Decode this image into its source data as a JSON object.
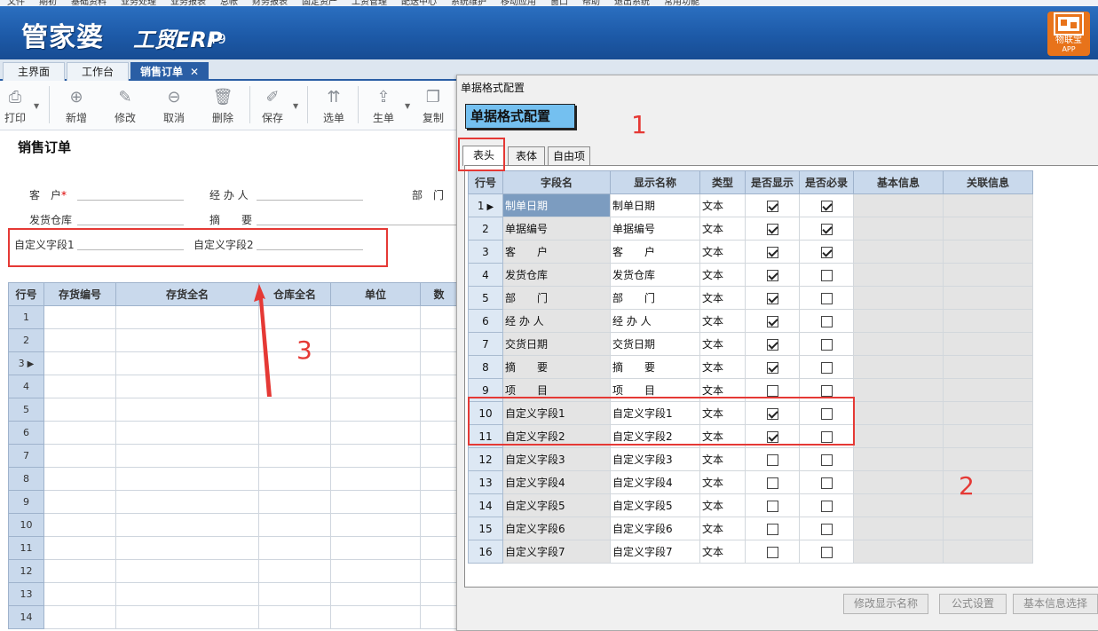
{
  "app": {
    "logo_cn": "管家婆",
    "logo_en": "工贸ERP",
    "logo_ver": "T9",
    "iot_label": "物联宝",
    "iot_sub": "APP"
  },
  "menu": [
    "文件",
    "期初",
    "基础资料",
    "业务处理",
    "业务报表",
    "总帐",
    "财务报表",
    "固定资产",
    "工资管理",
    "配送中心",
    "系统维护",
    "移动应用",
    "窗口",
    "帮助",
    "退出系统",
    "常用功能"
  ],
  "tabs": {
    "main": "主界面",
    "workbench": "工作台",
    "sales_order": "销售订单",
    "close": "✕"
  },
  "toolbar": {
    "print": "打印",
    "new": "新增",
    "edit": "修改",
    "cancel": "取消",
    "delete": "删除",
    "save": "保存",
    "select_doc": "选单",
    "generate": "生单",
    "copy": "复制"
  },
  "form": {
    "title": "销售订单",
    "customer": "客　户",
    "required_star": "*",
    "handler": "经 办 人",
    "dept": "部　门",
    "warehouse": "发货仓库",
    "summary": "摘　　要",
    "custom1": "自定义字段1",
    "custom2": "自定义字段2"
  },
  "grid": {
    "headers": [
      "行号",
      "存货编号",
      "存货全名",
      "仓库全名",
      "单位",
      "数"
    ],
    "rows": [
      "1",
      "2",
      "3",
      "4",
      "5",
      "6",
      "7",
      "8",
      "9",
      "10",
      "11",
      "12",
      "13",
      "14"
    ],
    "row_marker": "▶"
  },
  "dialog": {
    "window_title": "单据格式配置",
    "badge": "单据格式配置",
    "tabs": [
      "表头",
      "表体",
      "自由项"
    ],
    "headers": [
      "行号",
      "字段名",
      "显示名称",
      "类型",
      "是否显示",
      "是否必录",
      "基本信息",
      "关联信息"
    ],
    "rows": [
      {
        "no": "1",
        "field": "制单日期",
        "display": "制单日期",
        "type": "文本",
        "show": true,
        "required": true
      },
      {
        "no": "2",
        "field": "单据编号",
        "display": "单据编号",
        "type": "文本",
        "show": true,
        "required": true
      },
      {
        "no": "3",
        "field": "客　　户",
        "display": "客　　户",
        "type": "文本",
        "show": true,
        "required": true
      },
      {
        "no": "4",
        "field": "发货仓库",
        "display": "发货仓库",
        "type": "文本",
        "show": true,
        "required": false
      },
      {
        "no": "5",
        "field": "部　　门",
        "display": "部　　门",
        "type": "文本",
        "show": true,
        "required": false
      },
      {
        "no": "6",
        "field": "经 办 人",
        "display": "经 办 人",
        "type": "文本",
        "show": true,
        "required": false
      },
      {
        "no": "7",
        "field": "交货日期",
        "display": "交货日期",
        "type": "文本",
        "show": true,
        "required": false
      },
      {
        "no": "8",
        "field": "摘　　要",
        "display": "摘　　要",
        "type": "文本",
        "show": true,
        "required": false
      },
      {
        "no": "9",
        "field": "项　　目",
        "display": "项　　目",
        "type": "文本",
        "show": false,
        "required": false
      },
      {
        "no": "10",
        "field": "自定义字段1",
        "display": "自定义字段1",
        "type": "文本",
        "show": true,
        "required": false
      },
      {
        "no": "11",
        "field": "自定义字段2",
        "display": "自定义字段2",
        "type": "文本",
        "show": true,
        "required": false
      },
      {
        "no": "12",
        "field": "自定义字段3",
        "display": "自定义字段3",
        "type": "文本",
        "show": false,
        "required": false
      },
      {
        "no": "13",
        "field": "自定义字段4",
        "display": "自定义字段4",
        "type": "文本",
        "show": false,
        "required": false
      },
      {
        "no": "14",
        "field": "自定义字段5",
        "display": "自定义字段5",
        "type": "文本",
        "show": false,
        "required": false
      },
      {
        "no": "15",
        "field": "自定义字段6",
        "display": "自定义字段6",
        "type": "文本",
        "show": false,
        "required": false
      },
      {
        "no": "16",
        "field": "自定义字段7",
        "display": "自定义字段7",
        "type": "文本",
        "show": false,
        "required": false
      }
    ],
    "buttons": [
      "修改显示名称",
      "公式设置",
      "基本信息选择"
    ]
  },
  "annotations": {
    "a1": "1",
    "a2": "2",
    "a3": "3",
    "color": "#e53935"
  }
}
